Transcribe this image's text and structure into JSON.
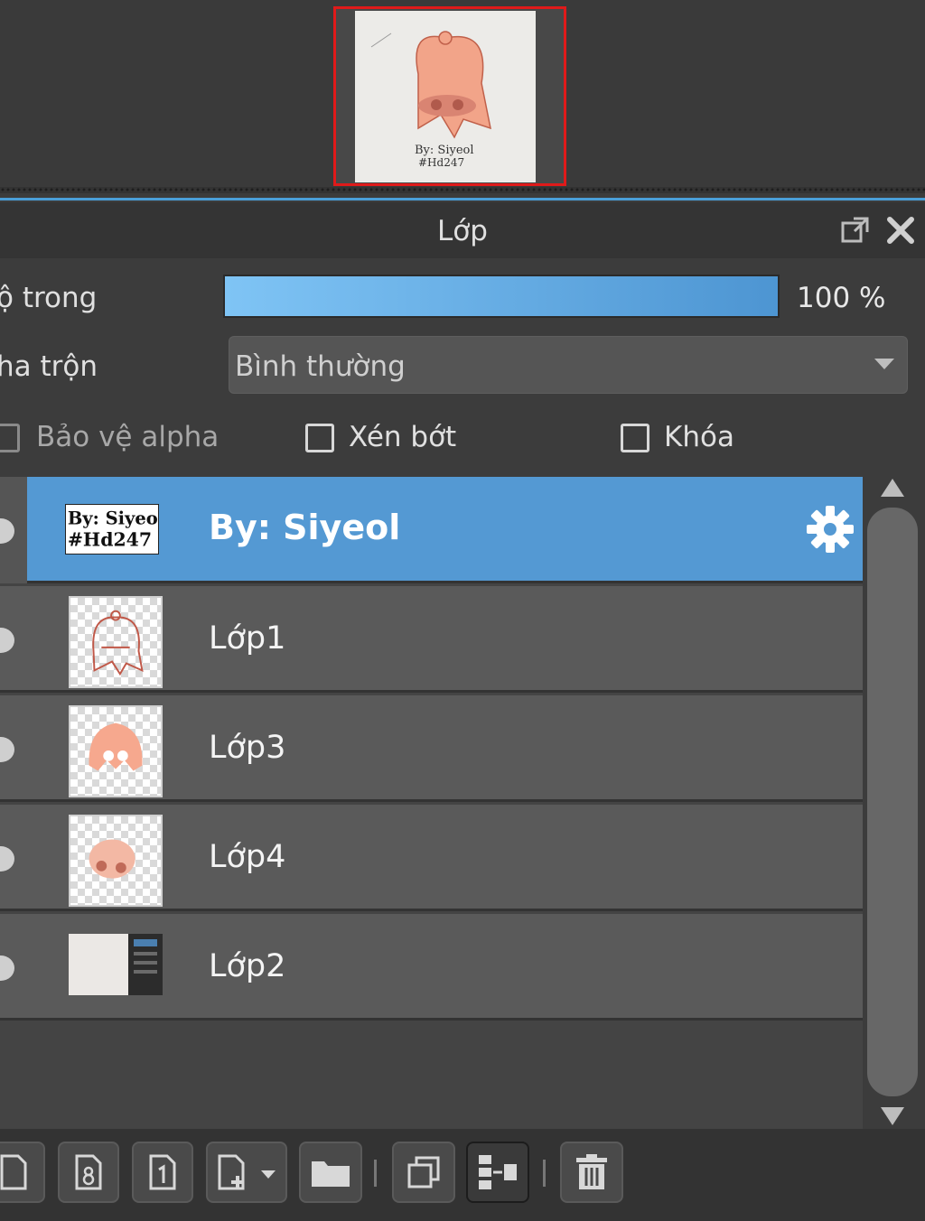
{
  "navigator": {
    "preview_text_line1": "By: Siyeol",
    "preview_text_line2": "#Hd247"
  },
  "panel": {
    "title": "Lớp",
    "popout_icon": "popout-icon",
    "close_icon": "close-icon"
  },
  "opacity": {
    "label": "ộ trong",
    "value_text": "100 %",
    "value": 100,
    "fill_color_start": "#7fc4f5",
    "fill_color_end": "#4d95d2"
  },
  "blend": {
    "label": "ha trộn",
    "selected": "Bình thường"
  },
  "checkboxes": {
    "alpha_protect": "Bảo vệ alpha",
    "clipping": "Xén bớt",
    "lock": "Khóa"
  },
  "layers": [
    {
      "name": "By: Siyeol",
      "thumb_text_1": "By: Siyeol",
      "thumb_text_2": "#Hd247",
      "active": true
    },
    {
      "name": "Lớp1",
      "active": false
    },
    {
      "name": "Lớp3",
      "active": false
    },
    {
      "name": "Lớp4",
      "active": false
    },
    {
      "name": "Lớp2",
      "active": false
    }
  ],
  "colors": {
    "active_row": "#5499d3",
    "row": "#5a5a5a",
    "accent_border": "#e01a1a"
  },
  "toolbar": {
    "icons": [
      "new-layer-icon",
      "new-8bit-layer-icon",
      "new-1bit-layer-icon",
      "add-layer-dropdown-icon",
      "new-folder-icon",
      "duplicate-layer-icon",
      "merge-layer-icon",
      "delete-layer-icon"
    ]
  }
}
